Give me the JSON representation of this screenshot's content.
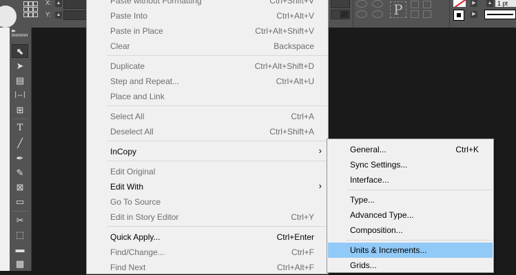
{
  "control_bar": {
    "x_label": "X:",
    "y_label": "Y:",
    "proxy_glyph": "P",
    "stroke_weight": "1 pt",
    "no_stroke_color": "#d8222a"
  },
  "tools": [
    {
      "name": "selection-tool",
      "glyph": "⬉"
    },
    {
      "name": "direct-selection-tool",
      "glyph": "➤"
    },
    {
      "name": "page-tool",
      "glyph": "▤"
    },
    {
      "name": "gap-tool",
      "glyph": "|↔|"
    },
    {
      "name": "content-collector-tool",
      "glyph": "⊞"
    },
    {
      "name": "type-tool",
      "glyph": "T"
    },
    {
      "name": "line-tool",
      "glyph": "╱"
    },
    {
      "name": "pen-tool",
      "glyph": "✒"
    },
    {
      "name": "pencil-tool",
      "glyph": "✎"
    },
    {
      "name": "rectangle-frame-tool",
      "glyph": "⊠"
    },
    {
      "name": "rectangle-tool",
      "glyph": "▭"
    },
    {
      "name": "scissors-tool",
      "glyph": "✂"
    },
    {
      "name": "free-transform-tool",
      "glyph": "⬚"
    },
    {
      "name": "gradient-swatch-tool",
      "glyph": "▬"
    },
    {
      "name": "gradient-feather-tool",
      "glyph": "▩"
    }
  ],
  "edit_menu": {
    "items": [
      {
        "label": "Paste without Formatting",
        "shortcut": "Ctrl+Shift+V",
        "disabled": true
      },
      {
        "label": "Paste Into",
        "shortcut": "Ctrl+Alt+V",
        "disabled": true
      },
      {
        "label": "Paste in Place",
        "shortcut": "Ctrl+Alt+Shift+V",
        "disabled": true
      },
      {
        "label": "Clear",
        "shortcut": "Backspace",
        "disabled": true
      },
      {
        "label": "Duplicate",
        "shortcut": "Ctrl+Alt+Shift+D",
        "disabled": true
      },
      {
        "label": "Step and Repeat...",
        "shortcut": "Ctrl+Alt+U",
        "disabled": true
      },
      {
        "label": "Place and Link",
        "shortcut": "",
        "disabled": true
      },
      {
        "label": "Select All",
        "shortcut": "Ctrl+A",
        "disabled": true
      },
      {
        "label": "Deselect All",
        "shortcut": "Ctrl+Shift+A",
        "disabled": true
      },
      {
        "label": "InCopy",
        "shortcut": "",
        "disabled": false
      },
      {
        "label": "Edit Original",
        "shortcut": "",
        "disabled": true
      },
      {
        "label": "Edit With",
        "shortcut": "",
        "disabled": false
      },
      {
        "label": "Go To Source",
        "shortcut": "",
        "disabled": true
      },
      {
        "label": "Edit in Story Editor",
        "shortcut": "Ctrl+Y",
        "disabled": true
      },
      {
        "label": "Quick Apply...",
        "shortcut": "Ctrl+Enter",
        "disabled": false
      },
      {
        "label": "Find/Change...",
        "shortcut": "Ctrl+F",
        "disabled": true
      },
      {
        "label": "Find Next",
        "shortcut": "Ctrl+Alt+F",
        "disabled": true
      }
    ],
    "submenu_arrow": "›"
  },
  "preferences_submenu": {
    "items": [
      {
        "label": "General...",
        "shortcut": "Ctrl+K"
      },
      {
        "label": "Sync Settings...",
        "shortcut": ""
      },
      {
        "label": "Interface...",
        "shortcut": ""
      },
      {
        "label": "Type...",
        "shortcut": ""
      },
      {
        "label": "Advanced Type...",
        "shortcut": ""
      },
      {
        "label": "Composition...",
        "shortcut": ""
      },
      {
        "label": "Units & Increments...",
        "shortcut": "",
        "highlighted": true
      },
      {
        "label": "Grids...",
        "shortcut": ""
      }
    ],
    "highlight_color": "#91c9f7"
  }
}
